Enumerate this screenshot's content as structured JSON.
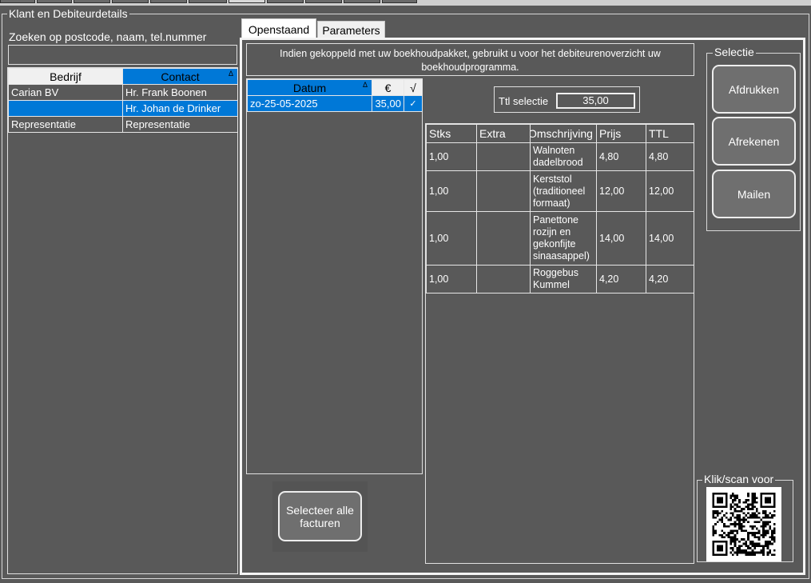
{
  "left_panel": {
    "title": "Klant en Debiteurdetails",
    "search_label": "Zoeken op postcode, naam, tel.nummer",
    "search_value": "",
    "columns": [
      "Bedrijf",
      "Contact"
    ],
    "sort_indicator": "Δ",
    "rows": [
      {
        "bedrijf": "Carian BV",
        "contact": "Hr. Frank Boonen"
      },
      {
        "bedrijf": "",
        "contact": "Hr. Johan de Drinker"
      },
      {
        "bedrijf": "Representatie",
        "contact": "Representatie"
      }
    ]
  },
  "tabs": [
    {
      "label": "Openstaand",
      "active": true
    },
    {
      "label": "Parameters",
      "active": false
    }
  ],
  "info_text": "Indien gekoppeld met  uw boekhoudpakket, gebruikt u voor het debiteurenoverzicht uw boekhoudprogramma.",
  "invoice_grid": {
    "columns": [
      "Datum",
      "€",
      "√"
    ],
    "sort_indicator": "Δ",
    "rows": [
      {
        "datum": "zo-25-05-2025",
        "bedrag": "35,00",
        "check": "✓"
      }
    ]
  },
  "total_selection": {
    "label": "Ttl selectie",
    "value": "35,00"
  },
  "detail_grid": {
    "columns": [
      "Stks",
      "Extra",
      "Omschrijving",
      "Prijs",
      "TTL"
    ],
    "rows": [
      {
        "stks": "1,00",
        "extra": "",
        "omschrijving": "Walnoten dadelbrood",
        "prijs": "4,80",
        "ttl": "4,80"
      },
      {
        "stks": "1,00",
        "extra": "",
        "omschrijving": "Kerststol (traditioneel formaat)",
        "prijs": "12,00",
        "ttl": "12,00"
      },
      {
        "stks": "1,00",
        "extra": "",
        "omschrijving": "Panettone rozijn en gekonfijte sinaasappel)",
        "prijs": "14,00",
        "ttl": "14,00"
      },
      {
        "stks": "1,00",
        "extra": "",
        "omschrijving": "Roggebus Kummel",
        "prijs": "4,20",
        "ttl": "4,20"
      }
    ]
  },
  "select_all_button": "Selecteer alle facturen",
  "selectie": {
    "title": "Selectie",
    "buttons": [
      "Afdrukken",
      "Afrekenen",
      "Mailen"
    ]
  },
  "scan": {
    "title": "Klik/scan voor",
    "qr_icon": "qr-code-icon"
  },
  "colors": {
    "background": "#595959",
    "selection_blue": "#0078d7",
    "button": "#6f6f6f"
  }
}
